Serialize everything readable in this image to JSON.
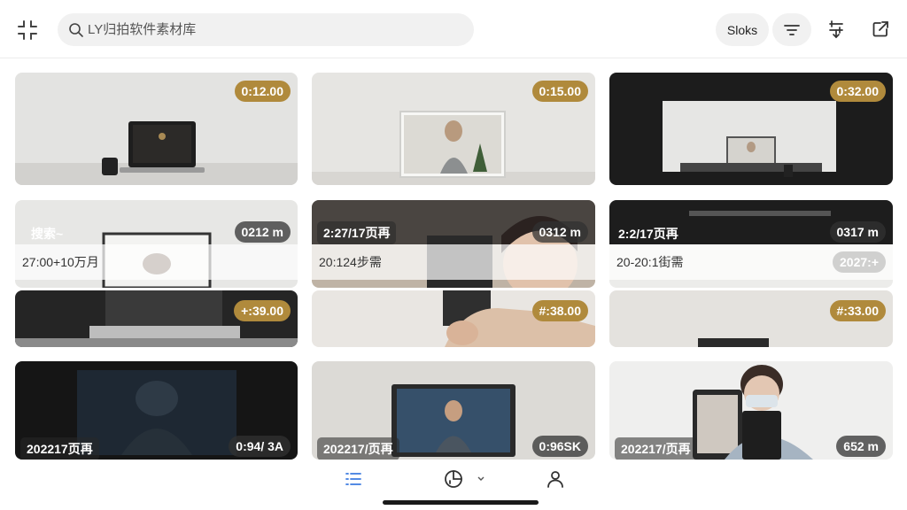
{
  "header": {
    "search_placeholder": "LY归拍软件素材库",
    "text_button": "Sloks",
    "icons": [
      "collapse-grid-icon",
      "search-icon",
      "filter-icon",
      "adjust-icon",
      "share-icon"
    ]
  },
  "cards": [
    {
      "duration": "0:12.00"
    },
    {
      "duration": "0:15.00"
    },
    {
      "duration": "0:32.00"
    },
    {
      "title": "搜索~",
      "duration": "0212 m",
      "date": "27:00+10万月"
    },
    {
      "title": "2:27/17页再",
      "duration": "0312 m",
      "date": "20:124步需"
    },
    {
      "title": "2:2/17页再",
      "duration": "0317 m",
      "date": "20-20:1街需",
      "extra": "2027:+"
    },
    {
      "duration": "+:39.00"
    },
    {
      "duration": "#:38.00"
    },
    {
      "duration": "#:33.00"
    },
    {
      "title": "202217页再",
      "duration": "0:94/ 3A"
    },
    {
      "title": "202217/页再",
      "duration": "0:96SK"
    },
    {
      "title": "202217/页再",
      "duration": "652 m"
    }
  ],
  "colors": {
    "badge_gold": "#b08a3c",
    "active_tab": "#3d7be0",
    "search_bg": "#f1f1f1"
  },
  "bottom_nav": {
    "icons": [
      "list-icon",
      "chart-icon",
      "caret-down-icon",
      "profile-icon"
    ],
    "active": "list-icon"
  }
}
